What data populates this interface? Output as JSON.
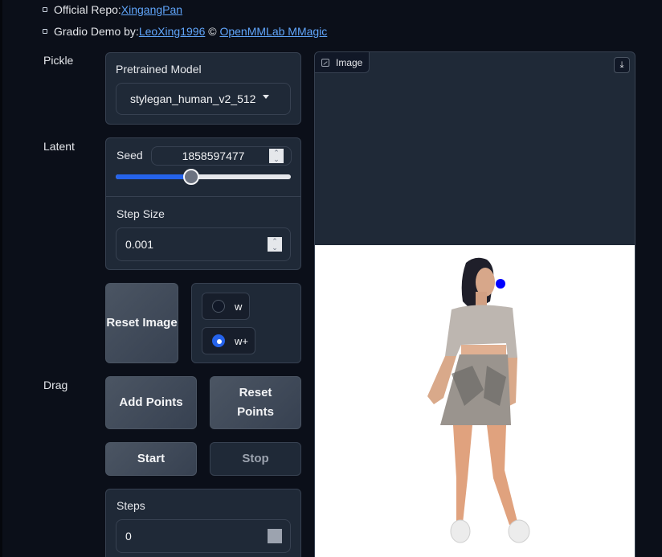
{
  "header": {
    "links": [
      {
        "prefix": "Official Repo: ",
        "items": [
          {
            "text": "XingangPan"
          }
        ]
      },
      {
        "prefix": "Gradio Demo by: ",
        "items": [
          {
            "text": "LeoXing1996"
          },
          {
            "sep": " © "
          },
          {
            "text": "OpenMMLab MMagic"
          }
        ]
      }
    ],
    "repo_prefix": "Official Repo: ",
    "repo_link": "XingangPan",
    "demo_prefix": "Gradio Demo by: ",
    "demo_link1": "LeoXing1996",
    "demo_sep": " © ",
    "demo_link2": "OpenMMLab MMagic"
  },
  "sections": {
    "pickle": "Pickle",
    "latent": "Latent",
    "drag": "Drag"
  },
  "pickle": {
    "label": "Pretrained Model",
    "value": "stylegan_human_v2_512"
  },
  "latent": {
    "seed_label": "Seed",
    "seed_value": "1858597477",
    "seed_slider_fraction": 0.43,
    "step_size_label": "Step Size",
    "step_size_value": "0.001",
    "reset_image_label": "Reset Image",
    "space_options": [
      {
        "label": "w",
        "checked": false
      },
      {
        "label": "w+",
        "checked": true
      }
    ]
  },
  "drag": {
    "add_points_label": "Add Points",
    "reset_points_label": "Reset Points",
    "start_label": "Start",
    "stop_label": "Stop",
    "steps_label": "Steps",
    "steps_value": "0"
  },
  "image": {
    "tab_label": "Image",
    "point_color": "#0000ff"
  },
  "colors": {
    "accent": "#2563eb",
    "background": "#0b0f19",
    "panel": "#1f2937",
    "link": "#60a5fa"
  }
}
